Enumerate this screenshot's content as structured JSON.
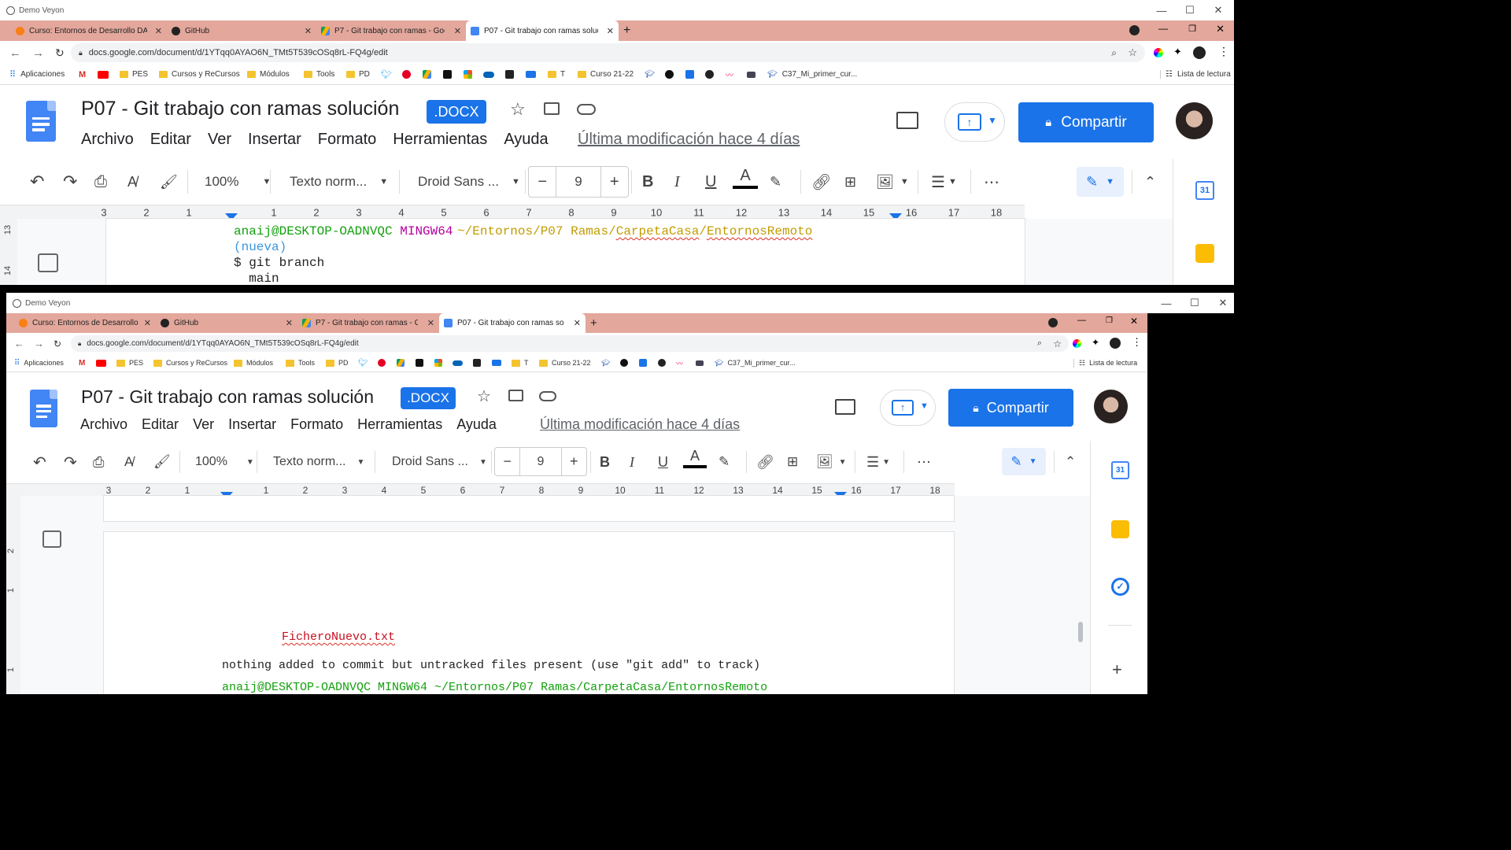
{
  "window": {
    "title": "Demo Veyon"
  },
  "browser": {
    "tabs": [
      {
        "label": "Curso: Entornos de Desarrollo DA",
        "icon": "moodle-icon"
      },
      {
        "label": "GitHub",
        "icon": "github-icon"
      },
      {
        "label": "P7 - Git trabajo con ramas - Goo",
        "icon": "drive-icon"
      },
      {
        "label": "P07 - Git trabajo con ramas soluc",
        "icon": "docs-icon"
      }
    ],
    "url": "docs.google.com/document/d/1YTqq0AYAO6N_TMt5T539cOSq8rL-FQ4g/edit",
    "bookmarks": [
      "Aplicaciones",
      "PES",
      "Cursos y ReCursos",
      "Módulos",
      "Tools",
      "PD",
      "T",
      "Curso 21-22",
      "C37_Mi_primer_cur..."
    ],
    "reading_list": "Lista de lectura"
  },
  "doc": {
    "title": "P07 - Git trabajo con ramas solución",
    "badge": ".DOCX",
    "menu": [
      "Archivo",
      "Editar",
      "Ver",
      "Insertar",
      "Formato",
      "Herramientas",
      "Ayuda"
    ],
    "last_edit": "Última modificación hace 4 días",
    "share": "Compartir"
  },
  "toolbar": {
    "zoom": "100%",
    "style": "Texto norm...",
    "font": "Droid Sans ...",
    "font_size": "9"
  },
  "ruler": {
    "left": [
      "3",
      "2",
      "1"
    ],
    "right": [
      "1",
      "2",
      "3",
      "4",
      "5",
      "6",
      "7",
      "8",
      "9",
      "10",
      "11",
      "12",
      "13",
      "14",
      "15",
      "16",
      "17",
      "18"
    ]
  },
  "top_content": {
    "side_ruler": [
      "13",
      "14"
    ],
    "prompt_user": "anaij@DESKTOP-OADNVQC",
    "prompt_mingw": "MINGW64",
    "prompt_path1": "~/Entornos/P07 Ramas/",
    "prompt_path2": "CarpetaCasa",
    "prompt_path3": "/",
    "prompt_path4": "EntornosRemoto",
    "branch": "(nueva)",
    "cmd": "$ git branch",
    "out": "  main"
  },
  "bottom_content": {
    "side_ruler": [
      "2",
      "1",
      "1"
    ],
    "file": "FicheroNuevo.txt",
    "msg": "nothing added to commit but untracked files present (use \"git add\" to track)",
    "cut_line": "anaij@DESKTOP-OADNVQC MINGW64 ~/Entornos/P07 Ramas/CarpetaCasa/EntornosRemoto"
  },
  "colors": {
    "tabbar": "#e3a79c",
    "accent": "#1a73e8",
    "prompt_green": "#13a10e",
    "prompt_magenta": "#b4009e",
    "prompt_yellow": "#c19c00",
    "branch_cyan": "#3a96dd"
  }
}
